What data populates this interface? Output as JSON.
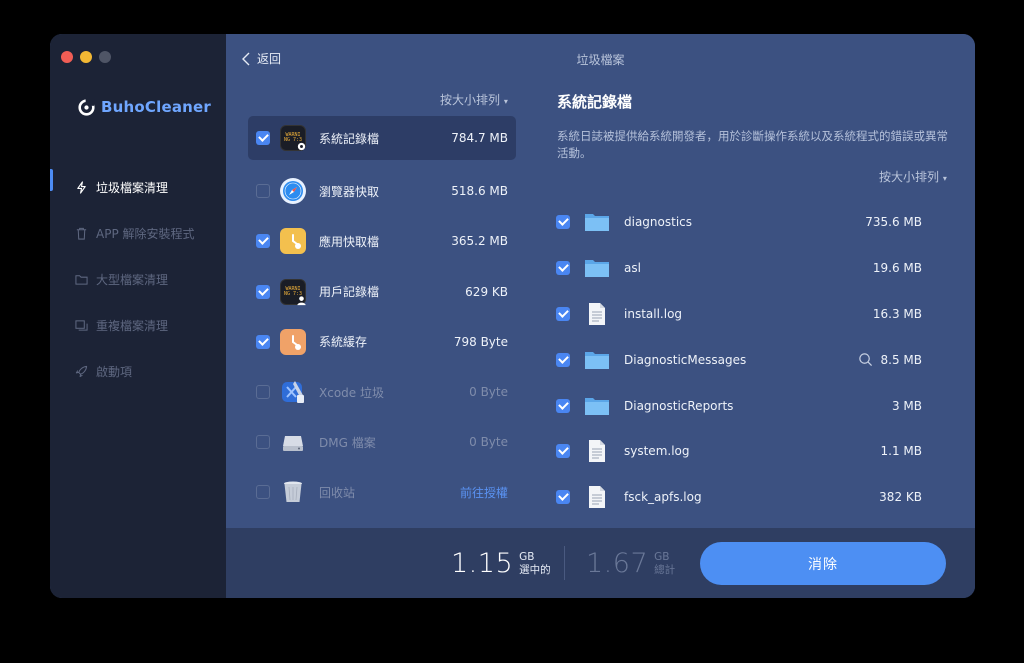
{
  "app": {
    "name": "BuhoCleaner"
  },
  "sidebar": {
    "items": [
      {
        "label": "垃圾檔案清理",
        "icon": "bolt-icon",
        "active": true
      },
      {
        "label": "APP 解除安裝程式",
        "icon": "trash-icon",
        "active": false
      },
      {
        "label": "大型檔案清理",
        "icon": "folder-icon",
        "active": false
      },
      {
        "label": "重複檔案清理",
        "icon": "duplicate-icon",
        "active": false
      },
      {
        "label": "啟動項",
        "icon": "rocket-icon",
        "active": false
      }
    ]
  },
  "header": {
    "back_label": "返回",
    "title": "垃圾檔案"
  },
  "categories": {
    "sort_label": "按大小排列",
    "items": [
      {
        "label": "系統記錄檔",
        "size": "784.7 MB",
        "checked": true,
        "icon": "system-log-icon"
      },
      {
        "label": "瀏覽器快取",
        "size": "518.6 MB",
        "checked": false,
        "icon": "safari-icon"
      },
      {
        "label": "應用快取檔",
        "size": "365.2 MB",
        "checked": true,
        "icon": "app-cache-icon"
      },
      {
        "label": "用戶記錄檔",
        "size": "629 KB",
        "checked": true,
        "icon": "user-log-icon"
      },
      {
        "label": "系統緩存",
        "size": "798 Byte",
        "checked": true,
        "icon": "system-cache-icon"
      },
      {
        "label": "Xcode 垃圾",
        "size": "0 Byte",
        "checked": false,
        "icon": "xcode-icon"
      },
      {
        "label": "DMG 檔案",
        "size": "0 Byte",
        "checked": false,
        "icon": "dmg-icon"
      },
      {
        "label": "回收站",
        "link": "前往授權",
        "checked": false,
        "icon": "trash-bin-icon"
      }
    ]
  },
  "detail": {
    "title": "系統記錄檔",
    "description": "系統日誌被提供給系統開發者，用於診斷操作系統以及系統程式的錯誤或異常活動。",
    "sort_label": "按大小排列",
    "files": [
      {
        "name": "diagnostics",
        "size": "735.6 MB",
        "type": "folder"
      },
      {
        "name": "asl",
        "size": "19.6 MB",
        "type": "folder"
      },
      {
        "name": "install.log",
        "size": "16.3 MB",
        "type": "file"
      },
      {
        "name": "DiagnosticMessages",
        "size": "8.5 MB",
        "type": "folder"
      },
      {
        "name": "DiagnosticReports",
        "size": "3 MB",
        "type": "folder"
      },
      {
        "name": "system.log",
        "size": "1.1 MB",
        "type": "file"
      },
      {
        "name": "fsck_apfs.log",
        "size": "382 KB",
        "type": "file"
      }
    ]
  },
  "footer": {
    "selected_value": "1.15",
    "selected_unit": "GB",
    "selected_label": "選中的",
    "total_value": "1.67",
    "total_unit": "GB",
    "total_label": "總計",
    "clean_label": "消除"
  },
  "colors": {
    "accent": "#4d8ff3",
    "sidebar": "#1c2336",
    "main": "#3c5181",
    "footer": "#2f3e62"
  }
}
